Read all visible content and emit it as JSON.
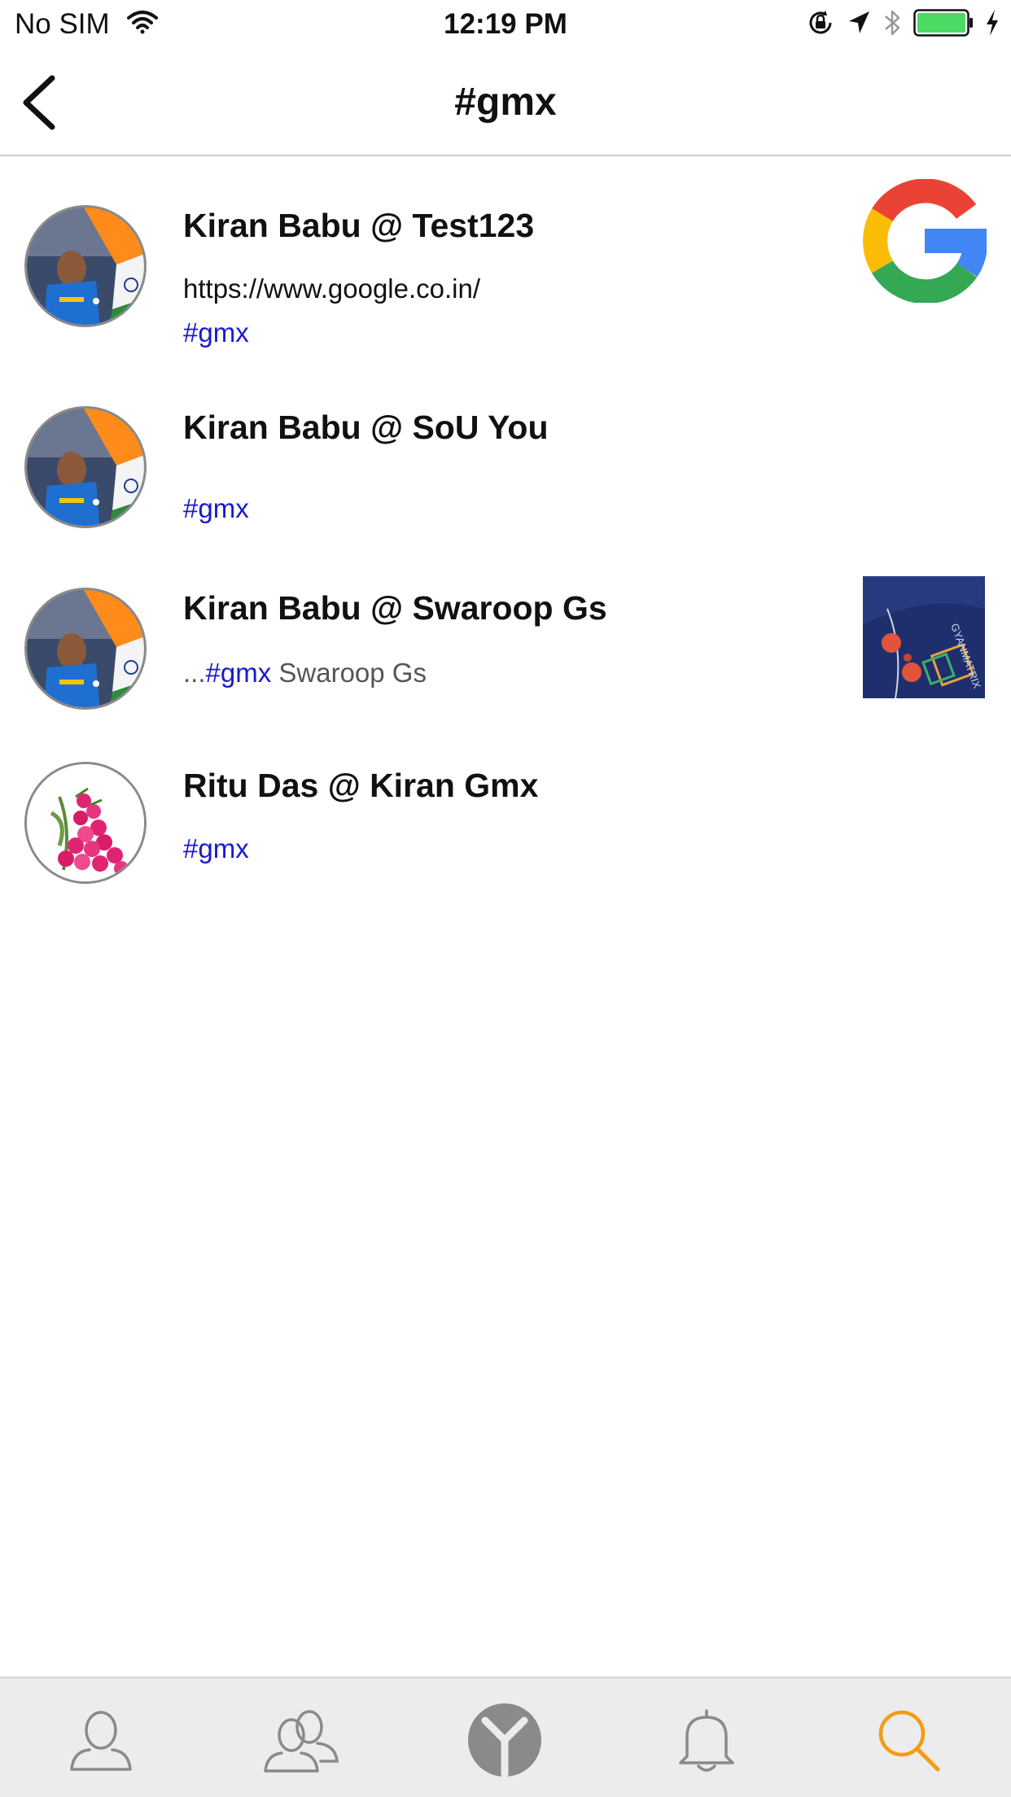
{
  "status_bar": {
    "carrier": "No SIM",
    "time": "12:19 PM"
  },
  "nav": {
    "title": "#gmx"
  },
  "feed": [
    {
      "author": "Kiran Babu @ Test123",
      "link": "https://www.google.co.in/",
      "tag": "#gmx",
      "thumbnail": "google-logo"
    },
    {
      "author": "Kiran Babu @ SoU You",
      "tag": "#gmx"
    },
    {
      "author": "Kiran Babu @ Swaroop Gs",
      "prefix": "...",
      "tag": "#gmx",
      "suffix": " Swaroop Gs",
      "thumbnail": "photo-earphones-gyanmatrix"
    },
    {
      "author": "Ritu Das @ Kiran Gmx",
      "tag": "#gmx"
    }
  ],
  "tab_bar": {
    "tabs": [
      "profile-icon",
      "friends-icon",
      "home-logo-icon",
      "notifications-icon",
      "search-icon"
    ],
    "active": "search-icon"
  },
  "colors": {
    "tag": "#1a1acc",
    "active_tab": "#f39c12",
    "inactive_tab": "#8a8a8a",
    "battery": "#4cd964"
  }
}
